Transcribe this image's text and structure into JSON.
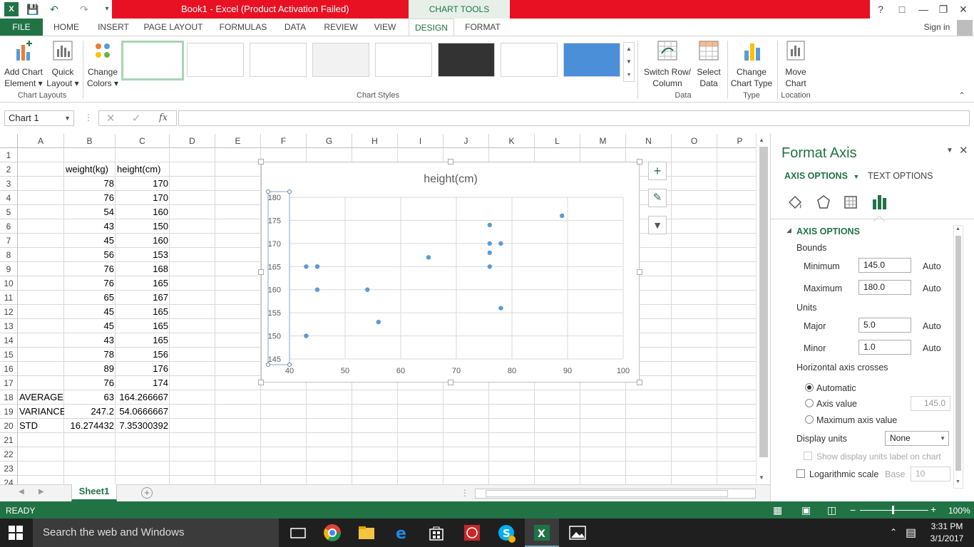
{
  "titlebar": {
    "title": "Book1 -  Excel (Product Activation Failed)",
    "context_tab": "CHART TOOLS",
    "help": "?",
    "signin": "Sign in"
  },
  "tabs": [
    "FILE",
    "HOME",
    "INSERT",
    "PAGE LAYOUT",
    "FORMULAS",
    "DATA",
    "REVIEW",
    "VIEW",
    "DESIGN",
    "FORMAT"
  ],
  "ribbon": {
    "add_chart_element": [
      "Add Chart",
      "Element ▾"
    ],
    "quick_layout": [
      "Quick",
      "Layout ▾"
    ],
    "change_colors": [
      "Change",
      "Colors ▾"
    ],
    "switch_row_col": [
      "Switch Row/",
      "Column"
    ],
    "select_data": [
      "Select",
      "Data"
    ],
    "change_chart_type": [
      "Change",
      "Chart Type"
    ],
    "move_chart": [
      "Move",
      "Chart"
    ],
    "groups": {
      "chart_layouts": "Chart Layouts",
      "chart_styles": "Chart Styles",
      "data": "Data",
      "type": "Type",
      "location": "Location"
    }
  },
  "formula_bar": {
    "name_box": "Chart 1",
    "fx": "fx",
    "value": ""
  },
  "grid": {
    "columns": [
      "A",
      "B",
      "C",
      "D",
      "E",
      "F",
      "G",
      "H",
      "I",
      "J",
      "K",
      "L",
      "M",
      "N",
      "O",
      "P"
    ],
    "rows": [
      "1",
      "2",
      "3",
      "4",
      "5",
      "6",
      "7",
      "8",
      "9",
      "10",
      "11",
      "12",
      "13",
      "14",
      "15",
      "16",
      "17",
      "18",
      "19",
      "20",
      "21",
      "22",
      "23",
      "24"
    ],
    "header_b": "weight(kg)",
    "header_c": "height(cm)",
    "weights": [
      "78",
      "76",
      "54",
      "43",
      "45",
      "56",
      "76",
      "76",
      "65",
      "45",
      "45",
      "43",
      "78",
      "89",
      "76"
    ],
    "heights": [
      "170",
      "170",
      "160",
      "150",
      "160",
      "153",
      "168",
      "165",
      "167",
      "165",
      "165",
      "165",
      "156",
      "176",
      "174"
    ],
    "stats": [
      {
        "label": "AVERAGE",
        "b": "63",
        "c": "164.266667"
      },
      {
        "label": "VARIANCE",
        "b": "247.2",
        "c": "54.0666667"
      },
      {
        "label": "STD",
        "b": "16.274432",
        "c": "7.35300392"
      }
    ]
  },
  "sheet_tab": "Sheet1",
  "chart_data": {
    "type": "scatter",
    "title": "height(cm)",
    "xlabel": "",
    "ylabel": "",
    "x": [
      78,
      76,
      54,
      43,
      45,
      56,
      76,
      76,
      65,
      45,
      45,
      43,
      78,
      89,
      76
    ],
    "y": [
      170,
      170,
      160,
      150,
      160,
      153,
      168,
      165,
      167,
      165,
      165,
      165,
      156,
      176,
      174
    ],
    "xlim": [
      40,
      100
    ],
    "ylim": [
      145,
      180
    ],
    "xticks": [
      40,
      50,
      60,
      70,
      80,
      90,
      100
    ],
    "yticks": [
      145,
      150,
      155,
      160,
      165,
      170,
      175,
      180
    ],
    "grid": true,
    "marker_color": "#5b9bd5"
  },
  "format_pane": {
    "title": "Format Axis",
    "tab_axis": "AXIS OPTIONS",
    "tab_text": "TEXT OPTIONS",
    "section": "AXIS OPTIONS",
    "bounds_label": "Bounds",
    "minimum_label": "Minimum",
    "minimum_value": "145.0",
    "maximum_label": "Maximum",
    "maximum_value": "180.0",
    "auto": "Auto",
    "units_label": "Units",
    "major_label": "Major",
    "major_value": "5.0",
    "minor_label": "Minor",
    "minor_value": "1.0",
    "crosses_label": "Horizontal axis crosses",
    "radio_automatic": "Automatic",
    "radio_axis_value": "Axis value",
    "axis_value": "145.0",
    "radio_max": "Maximum axis value",
    "display_units_label": "Display units",
    "display_units_value": "None",
    "show_units_label": "Show display units label on chart",
    "log_scale_label": "Logarithmic scale",
    "base_label": "Base",
    "base_value": "10"
  },
  "status": {
    "ready": "READY",
    "zoom": "100%"
  },
  "taskbar": {
    "search": "Search the web and Windows",
    "time": "3:31 PM",
    "date": "3/1/2017"
  },
  "colors": {
    "excel_green": "#217346",
    "title_red": "#e81123",
    "marker": "#5b9bd5"
  }
}
